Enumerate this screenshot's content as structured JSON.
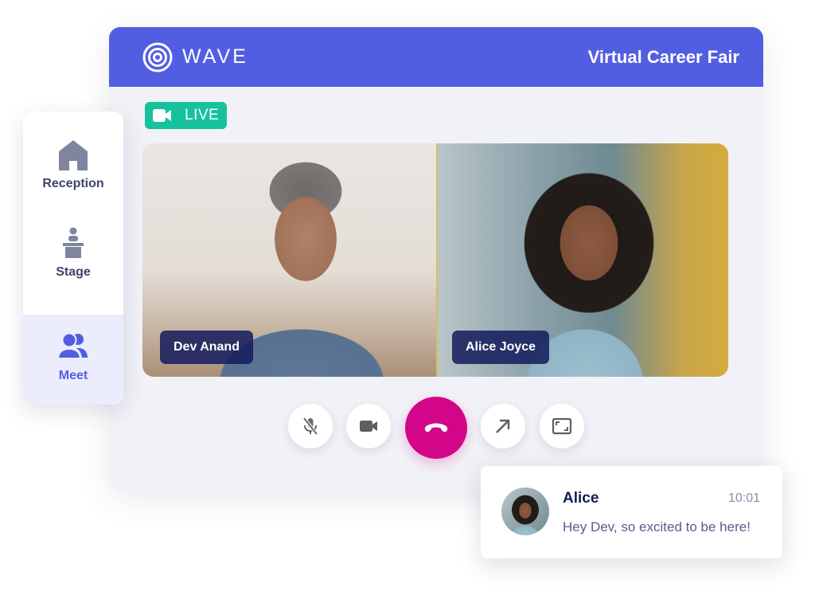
{
  "app": {
    "brand_name": "WAVE",
    "brand_icon": "concentric-circles-logo",
    "title": "Virtual Career Fair",
    "accent_color": "#525ee2"
  },
  "live_badge": {
    "label": "LIVE",
    "icon": "video-camera-icon",
    "color": "#16c29c"
  },
  "sidebar": {
    "items": [
      {
        "label": "Reception",
        "icon": "home-icon",
        "active": false
      },
      {
        "label": "Stage",
        "icon": "podium-icon",
        "active": false
      },
      {
        "label": "Meet",
        "icon": "people-icon",
        "active": true
      }
    ]
  },
  "video": {
    "participants": [
      {
        "name": "Dev Anand"
      },
      {
        "name": "Alice Joyce"
      }
    ]
  },
  "controls": {
    "buttons": [
      {
        "action": "mute",
        "icon": "mic-off-icon"
      },
      {
        "action": "camera",
        "icon": "video-camera-icon"
      },
      {
        "action": "end-call",
        "icon": "phone-hangup-icon",
        "color": "#d3068a"
      },
      {
        "action": "share",
        "icon": "arrow-up-right-icon"
      },
      {
        "action": "fullscreen",
        "icon": "fullscreen-icon"
      }
    ]
  },
  "chat": {
    "sender": "Alice",
    "time": "10:01",
    "message": "Hey Dev, so excited to be here!"
  }
}
